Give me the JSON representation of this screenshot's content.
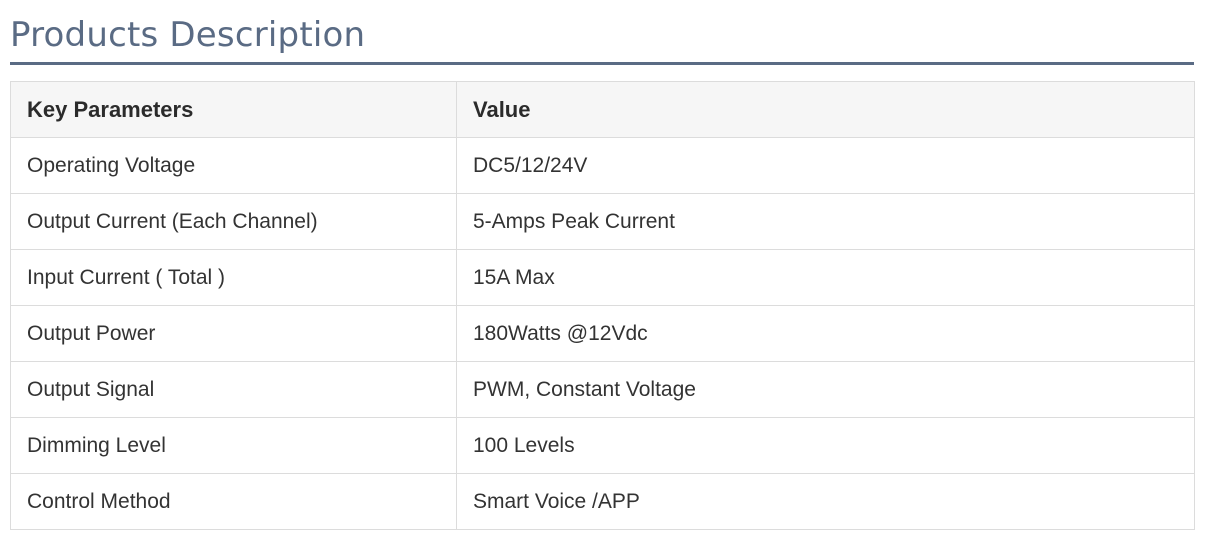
{
  "section": {
    "title": "Products Description"
  },
  "table": {
    "headers": {
      "param": "Key Parameters",
      "value": "Value"
    },
    "rows": [
      {
        "param": "Operating Voltage",
        "value": "DC5/12/24V"
      },
      {
        "param": "Output Current (Each Channel)",
        "value": "5-Amps Peak Current"
      },
      {
        "param": "Input Current ( Total )",
        "value": "15A Max"
      },
      {
        "param": "Output Power",
        "value": "180Watts @12Vdc"
      },
      {
        "param": "Output Signal",
        "value": "PWM, Constant Voltage"
      },
      {
        "param": "Dimming Level",
        "value": "100 Levels"
      },
      {
        "param": "Control Method",
        "value": "Smart Voice /APP"
      }
    ]
  },
  "colors": {
    "heading": "#5a6b84",
    "header_bg": "#f6f6f6",
    "border": "#dcdcdc",
    "text": "#333333"
  }
}
